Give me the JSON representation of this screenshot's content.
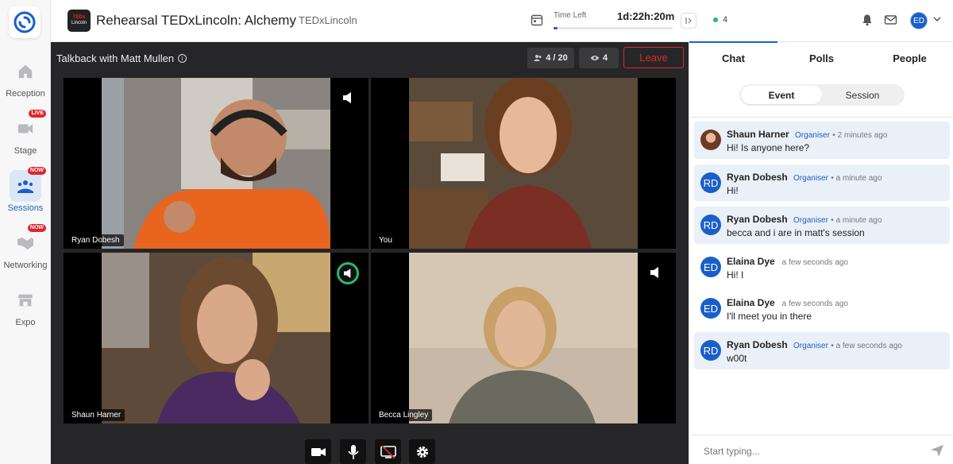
{
  "nav": {
    "items": [
      {
        "label": "Reception",
        "icon": "home-icon"
      },
      {
        "label": "Stage",
        "icon": "video-camera-icon",
        "badge": "LIVE"
      },
      {
        "label": "Sessions",
        "icon": "sessions-icon",
        "badge": "NOW"
      },
      {
        "label": "Networking",
        "icon": "handshake-icon",
        "badge": "NOW"
      },
      {
        "label": "Expo",
        "icon": "store-icon"
      }
    ]
  },
  "header": {
    "event_logo_top": "TEDx",
    "event_logo_bottom": "Lincoln",
    "title": "Rehearsal TEDxLincoln: Alchemy",
    "organizer": "TEDxLincoln",
    "time_left_label": "Time Left",
    "time_left_value": "1d:22h:20m",
    "time_progress": 0.03,
    "online_count": "4",
    "user_initials": "ED"
  },
  "stage": {
    "title": "Talkback with Matt Mullen",
    "participants": "4 / 20",
    "viewers": "4",
    "leave_label": "Leave",
    "tiles": [
      {
        "name": "Ryan Dobesh"
      },
      {
        "name": "You"
      },
      {
        "name": "Shaun Harner"
      },
      {
        "name": "Becca Lingley"
      }
    ]
  },
  "panel": {
    "tabs": [
      "Chat",
      "Polls",
      "People"
    ],
    "segments": [
      "Event",
      "Session"
    ],
    "messages": [
      {
        "initials": "",
        "name": "Shaun Harner",
        "role": "Organiser",
        "time": "2 minutes ago",
        "text": "Hi! Is anyone here?"
      },
      {
        "initials": "RD",
        "name": "Ryan Dobesh",
        "role": "Organiser",
        "time": "a minute ago",
        "text": "Hi!"
      },
      {
        "initials": "RD",
        "name": "Ryan Dobesh",
        "role": "Organiser",
        "time": "a minute ago",
        "text": "becca and i are in matt's session"
      },
      {
        "initials": "ED",
        "name": "Elaina Dye",
        "role": "",
        "time": "a few seconds ago",
        "text": "Hi! I"
      },
      {
        "initials": "ED",
        "name": "Elaina Dye",
        "role": "",
        "time": "a few seconds ago",
        "text": "I'll meet you in there"
      },
      {
        "initials": "RD",
        "name": "Ryan Dobesh",
        "role": "Organiser",
        "time": "a few seconds ago",
        "text": "w00t"
      }
    ],
    "composer_placeholder": "Start typing..."
  },
  "colors": {
    "accent": "#1a5fc8",
    "danger": "#e0262e",
    "online": "#2bb673"
  }
}
